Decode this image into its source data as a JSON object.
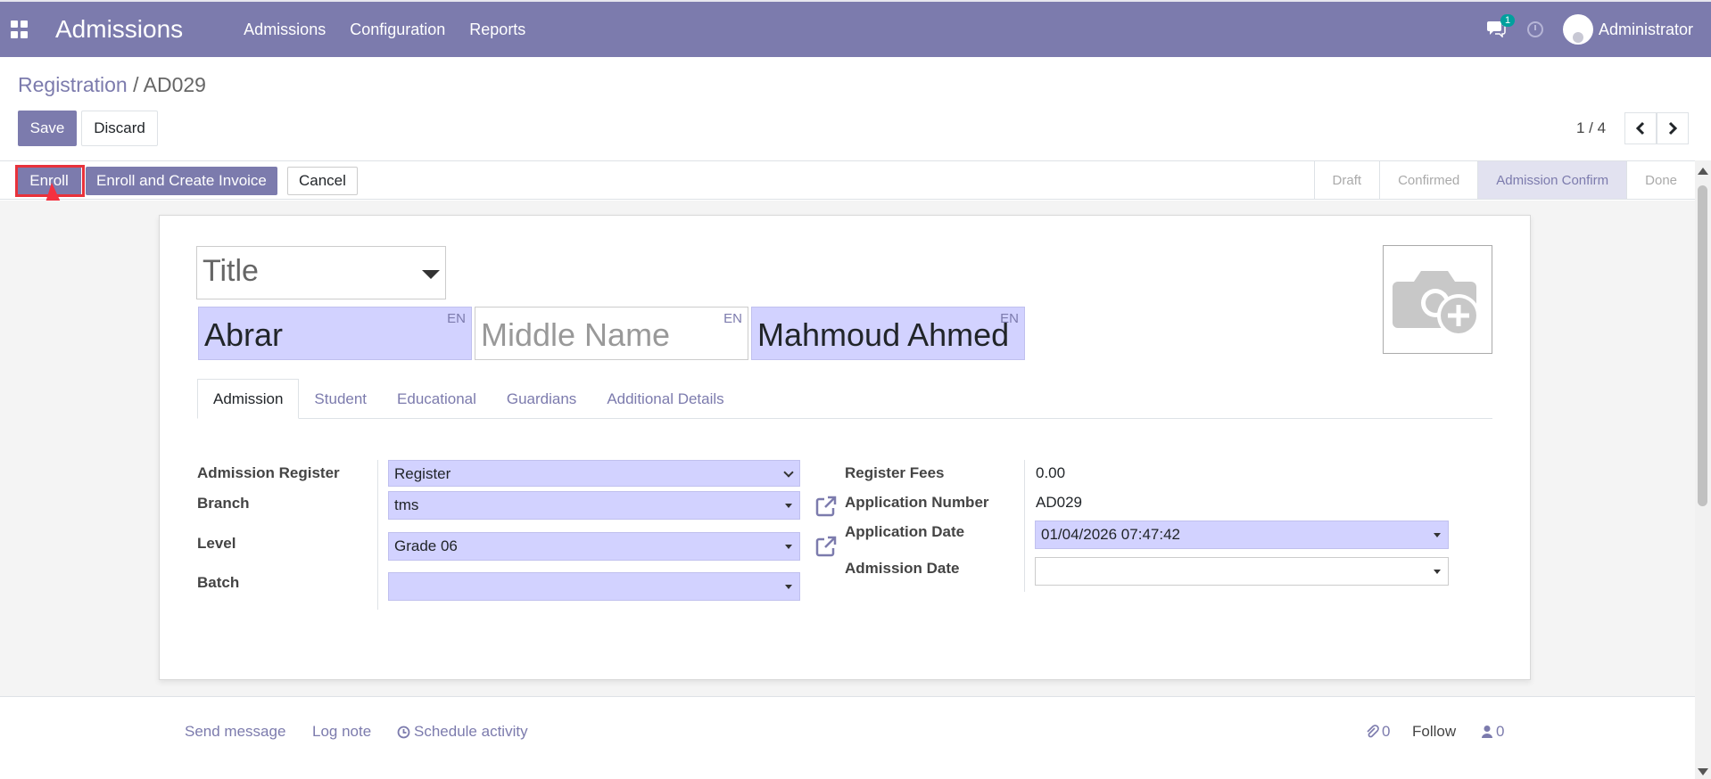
{
  "navbar": {
    "brand": "Admissions",
    "menu": [
      "Admissions",
      "Configuration",
      "Reports"
    ],
    "chat_count": "1",
    "user_name": "Administrator"
  },
  "breadcrumb": {
    "parent": "Registration",
    "separator": "/",
    "current": "AD029"
  },
  "toolbar": {
    "save_label": "Save",
    "discard_label": "Discard"
  },
  "pager": {
    "value": "1 / 4"
  },
  "statusbar": {
    "buttons": [
      "Enroll",
      "Enroll and Create Invoice",
      "Cancel"
    ],
    "stages": [
      "Draft",
      "Confirmed",
      "Admission Confirm",
      "Done"
    ],
    "active_stage": "Admission Confirm"
  },
  "form": {
    "title_placeholder": "Title",
    "first_name": "Abrar",
    "middle_name_placeholder": "Middle Name",
    "last_name": "Mahmoud Ahmed",
    "lang": "EN",
    "tabs": [
      "Admission",
      "Student",
      "Educational",
      "Guardians",
      "Additional Details"
    ],
    "active_tab": "Admission",
    "left": {
      "admission_register_label": "Admission Register",
      "admission_register_value": "Register",
      "branch_label": "Branch",
      "branch_value": "tms",
      "level_label": "Level",
      "level_value": "Grade 06",
      "batch_label": "Batch",
      "batch_value": ""
    },
    "right": {
      "register_fees_label": "Register Fees",
      "register_fees_value": "0.00",
      "application_number_label": "Application Number",
      "application_number_value": "AD029",
      "application_date_label": "Application Date",
      "application_date_value": "01/04/2026 07:47:42",
      "admission_date_label": "Admission Date",
      "admission_date_value": ""
    }
  },
  "chatter": {
    "send_message": "Send message",
    "log_note": "Log note",
    "schedule_activity": "Schedule activity",
    "attachments_count": "0",
    "follow": "Follow",
    "followers_count": "0"
  },
  "colors": {
    "brand": "#7c7bad",
    "required_field": "#d2d2ff",
    "annotation": "#e8323b"
  }
}
